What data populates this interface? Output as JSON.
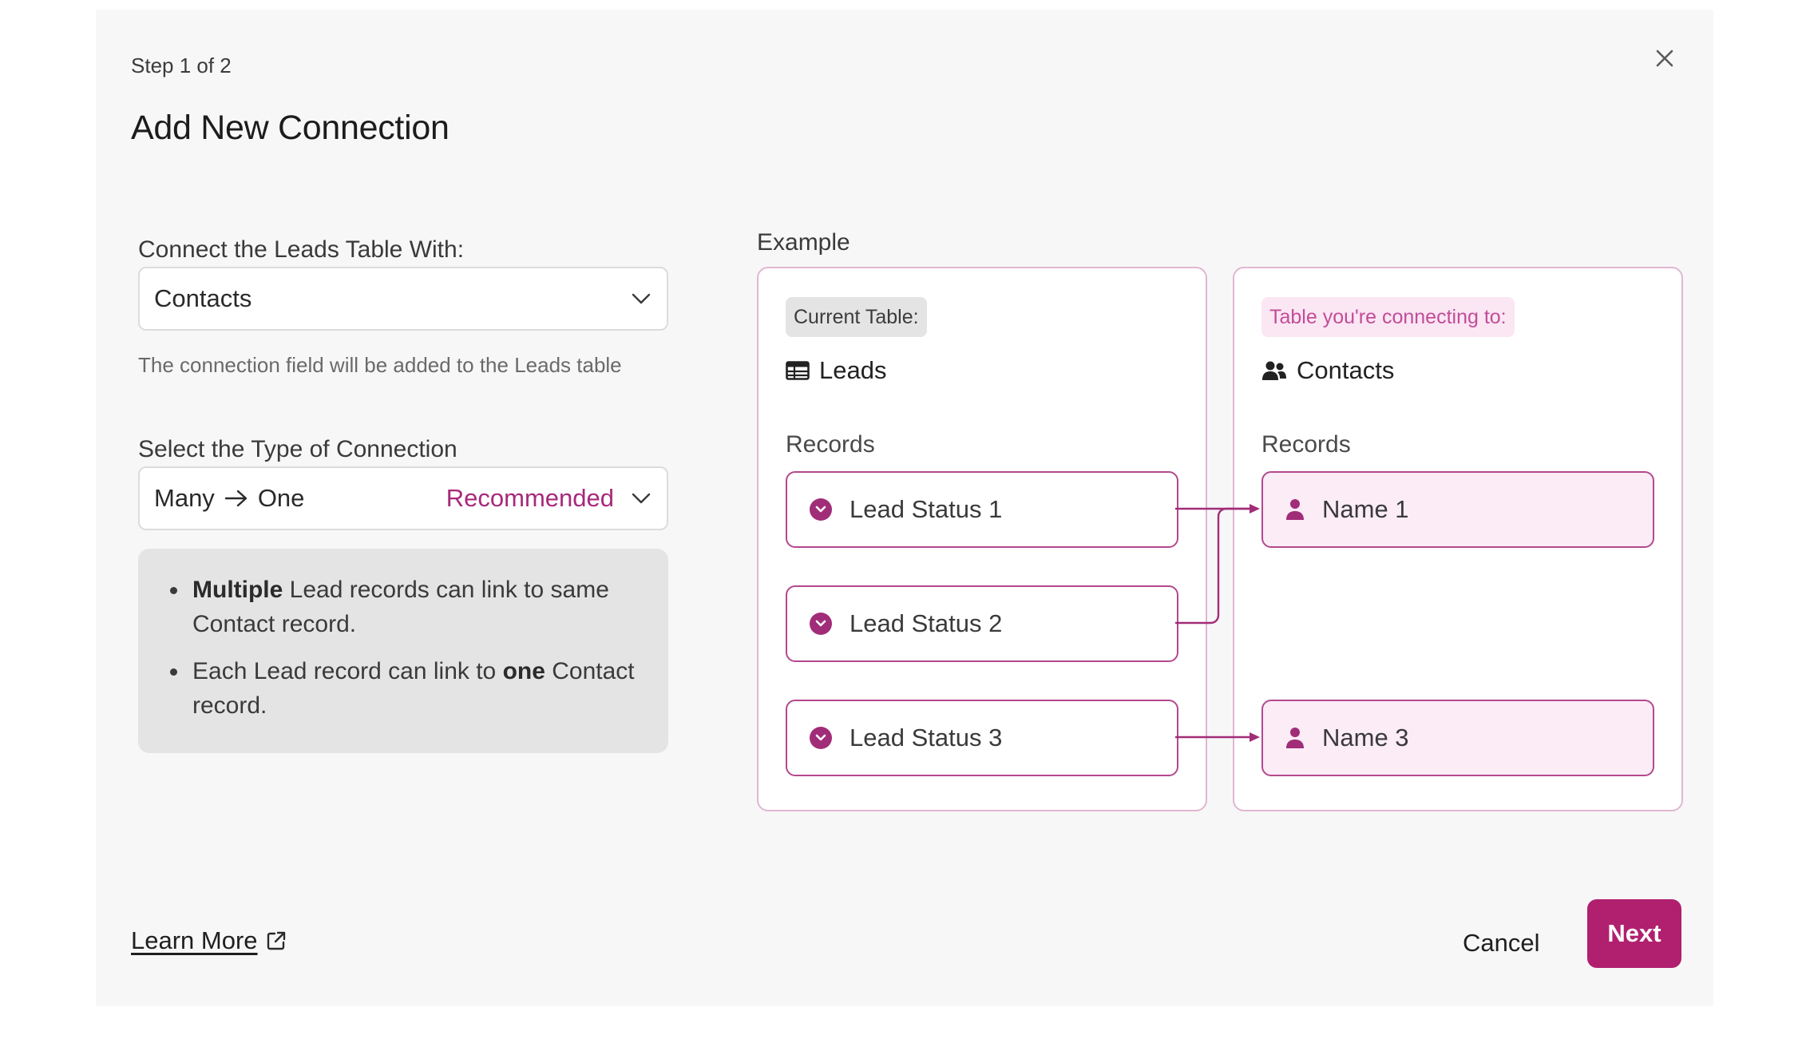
{
  "modal": {
    "step": "Step 1 of 2",
    "title": "Add New Connection"
  },
  "connect_field": {
    "label": "Connect the Leads Table With:",
    "value": "Contacts",
    "help": "The connection field will be added to the Leads table"
  },
  "type_field": {
    "label": "Select the Type of Connection",
    "value_from": "Many",
    "value_to": "One",
    "badge": "Recommended"
  },
  "info": {
    "item1_bold": "Multiple",
    "item1_rest": " Lead records can link to same Contact record.",
    "item2_start": "Each Lead record can link to ",
    "item2_bold": "one",
    "item2_end": " Contact record."
  },
  "example": {
    "label": "Example",
    "current": {
      "tag": "Current Table:",
      "name": "Leads",
      "records_label": "Records",
      "records": [
        "Lead Status 1",
        "Lead Status 2",
        "Lead Status 3"
      ]
    },
    "target": {
      "tag": "Table you're connecting to:",
      "name": "Contacts",
      "records_label": "Records",
      "records": [
        "Name 1",
        "Name 3"
      ]
    }
  },
  "footer": {
    "learn_more": "Learn More",
    "cancel": "Cancel",
    "next": "Next"
  },
  "colors": {
    "accent": "#b0206f",
    "accent_text": "#a8297a",
    "panel_border": "#e0b7d1",
    "record_border": "#b4488d",
    "info_bg": "#e5e4e5"
  }
}
